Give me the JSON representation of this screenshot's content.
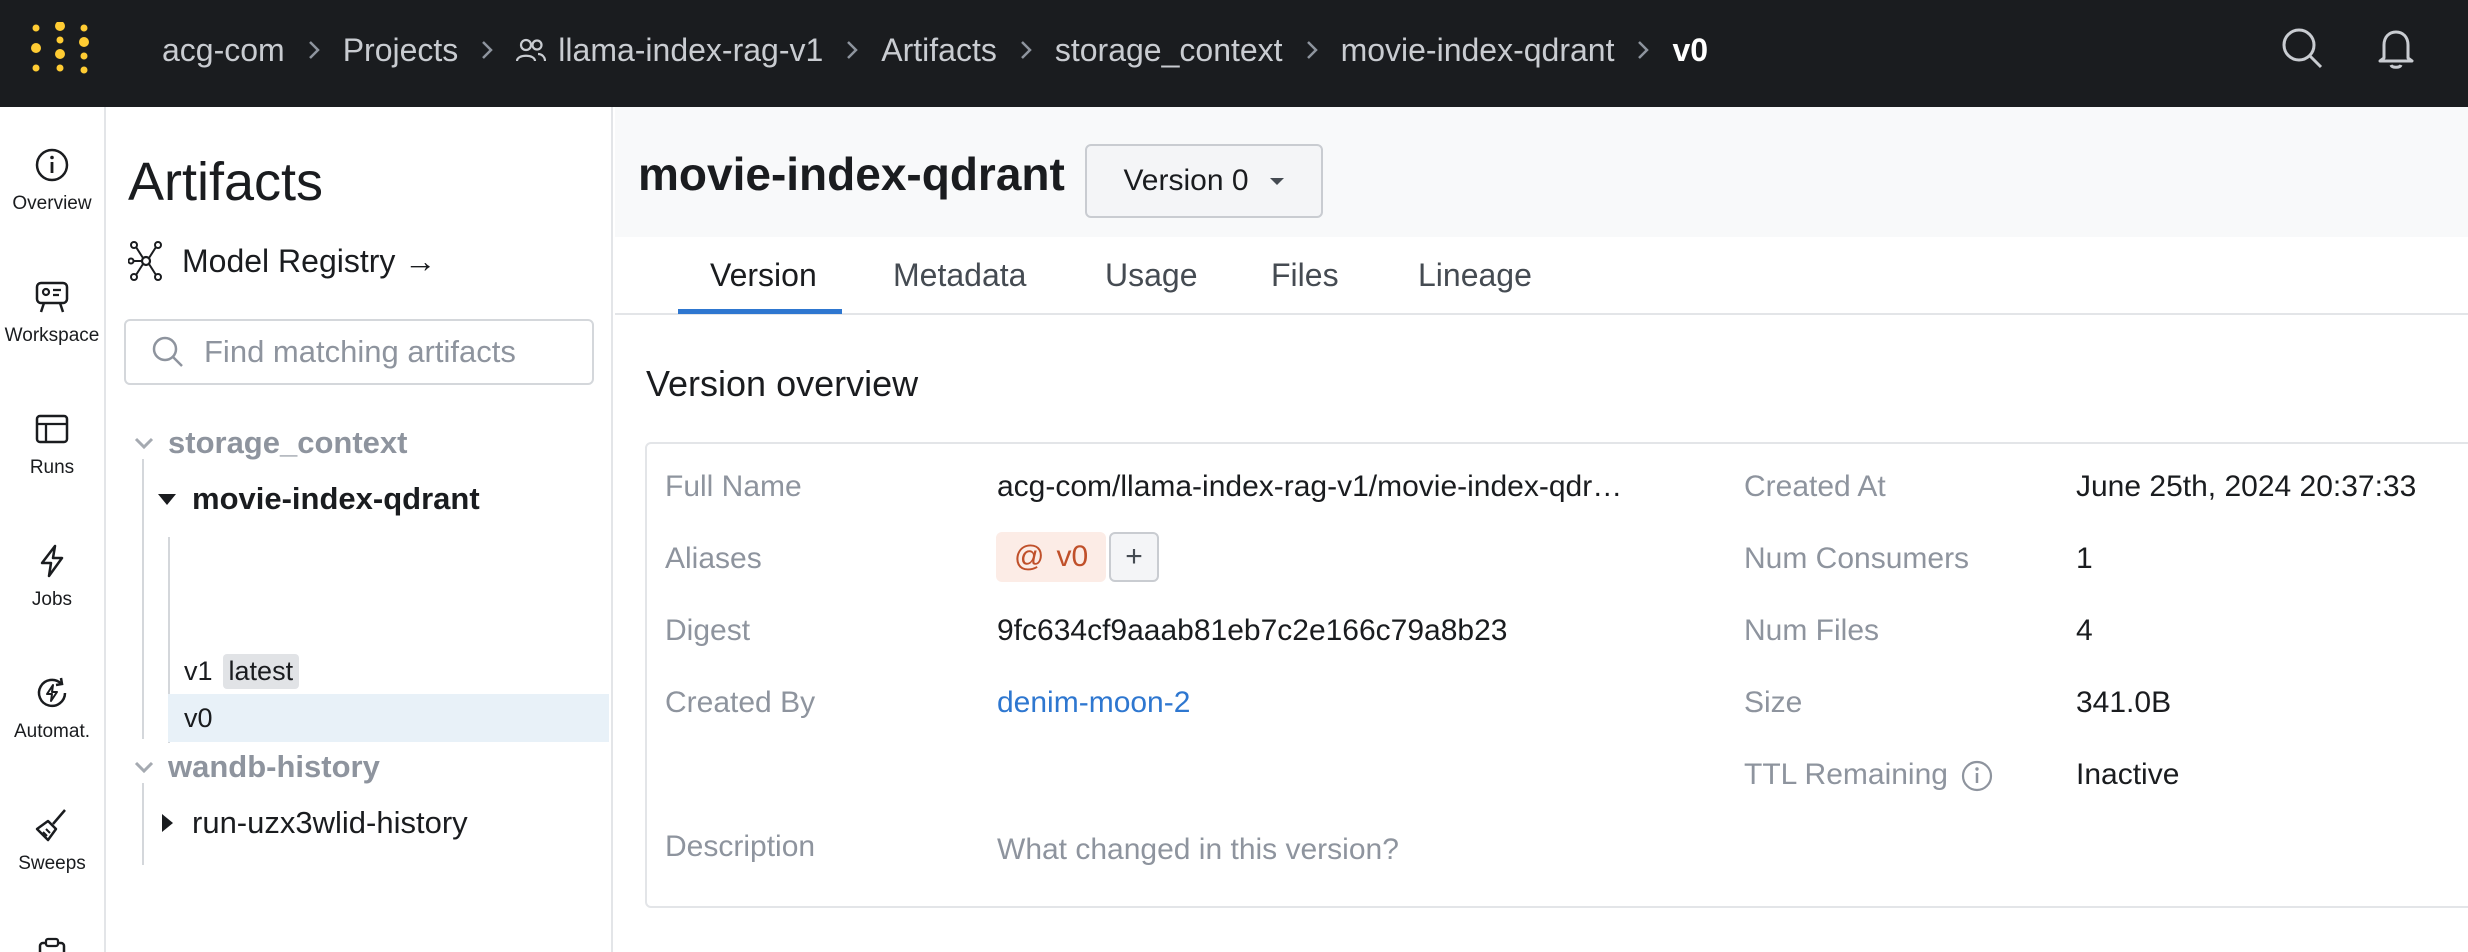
{
  "breadcrumb": {
    "items": [
      "acg-com",
      "Projects",
      "llama-index-rag-v1",
      "Artifacts",
      "storage_context",
      "movie-index-qdrant",
      "v0"
    ],
    "separator": ">"
  },
  "topbar": {
    "search_icon": "search-icon",
    "notifications_icon": "bell-icon"
  },
  "nav": {
    "items": [
      {
        "label": "Overview",
        "icon": "info-icon"
      },
      {
        "label": "Workspace",
        "icon": "workspace-icon"
      },
      {
        "label": "Runs",
        "icon": "runs-icon"
      },
      {
        "label": "Jobs",
        "icon": "bolt-icon"
      },
      {
        "label": "Automat.",
        "icon": "automations-icon"
      },
      {
        "label": "Sweeps",
        "icon": "broom-icon"
      }
    ]
  },
  "sidebar": {
    "title": "Artifacts",
    "registry_label": "Model Registry →",
    "search_placeholder": "Find matching artifacts",
    "tree": {
      "group1": "storage_context",
      "artifact": "movie-index-qdrant",
      "versions": [
        {
          "label": "v1",
          "badge": "latest",
          "selected": false
        },
        {
          "label": "v0",
          "badge": "",
          "selected": true
        }
      ],
      "group2": "wandb-history",
      "artifact2": "run-uzx3wlid-history"
    }
  },
  "main": {
    "title": "movie-index-qdrant",
    "version_select": "Version 0",
    "tabs": [
      "Version",
      "Metadata",
      "Usage",
      "Files",
      "Lineage"
    ],
    "active_tab": "Version",
    "section_title": "Version overview",
    "fields": {
      "full_name_label": "Full Name",
      "full_name": "acg-com/llama-index-rag-v1/movie-index-qdr…",
      "aliases_label": "Aliases",
      "alias": "v0",
      "alias_prefix": "@",
      "add_alias": "+",
      "digest_label": "Digest",
      "digest": "9fc634cf9aaab81eb7c2e166c79a8b23",
      "created_by_label": "Created By",
      "created_by": "denim-moon-2",
      "description_label": "Description",
      "description_placeholder": "What changed in this version?",
      "created_at_label": "Created At",
      "created_at": "June 25th, 2024 20:37:33",
      "num_consumers_label": "Num Consumers",
      "num_consumers": "1",
      "num_files_label": "Num Files",
      "num_files": "4",
      "size_label": "Size",
      "size": "341.0B",
      "ttl_label": "TTL Remaining",
      "ttl": "Inactive"
    }
  },
  "colors": {
    "accent": "#2e77d0",
    "topbar": "#1a1c1f",
    "logo": "#ffcc33",
    "alias": "#c0502a"
  }
}
